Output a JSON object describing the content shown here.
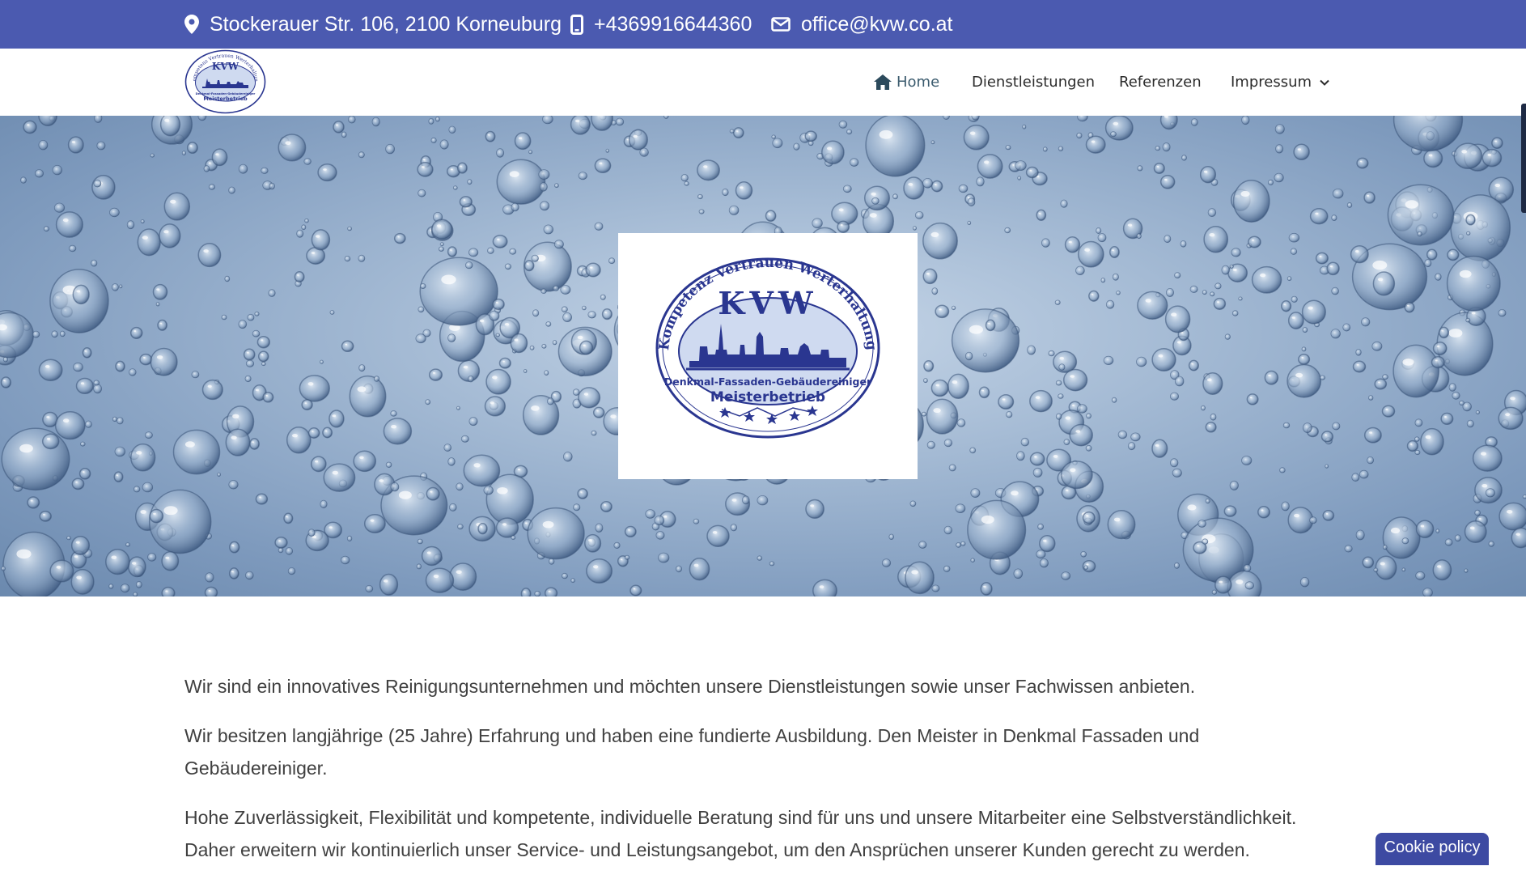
{
  "topbar": {
    "address": "Stockerauer Str. 106, 2100 Korneuburg",
    "phone": "+4369916644360",
    "email": "office@kvw.co.at",
    "icons": [
      "map-marker-icon",
      "mobile-phone-icon",
      "envelope-icon"
    ]
  },
  "logo": {
    "arc_text": "Kompetenz Vertrauen Werterhaltung",
    "initials": "KVW",
    "line1": "Denkmal-Fassaden-Gebäudereiniger",
    "line2": "Meisterbetrieb"
  },
  "nav": {
    "home": "Home",
    "dienstleistungen": "Dienstleistungen",
    "referenzen": "Referenzen",
    "impressum": "Impressum"
  },
  "content": {
    "p1": "Wir sind ein innovatives Reinigungsunternehmen und möchten unsere Dienstleistungen sowie unser Fachwissen anbieten.",
    "p2": "Wir besitzen langjährige (25 Jahre) Erfahrung und haben eine fundierte Ausbildung. Den Meister in Denkmal Fassaden und Gebäudereiniger.",
    "p3": "Hohe Zuverlässigkeit, Flexibilität und kompetente, individuelle Beratung sind für uns und unsere Mitarbeiter eine Selbstverständlichkeit. Daher erweitern wir kontinuierlich unser Service- und Leistungsangebot, um den Ansprüchen unserer Kunden gerecht zu werden."
  },
  "cookie": {
    "label": "Cookie policy"
  },
  "colors": {
    "topbar": "#4b5ab0",
    "logo_blue": "#2a3690",
    "cookie": "#3d4aa2",
    "nav_home": "#3b5b6e"
  }
}
